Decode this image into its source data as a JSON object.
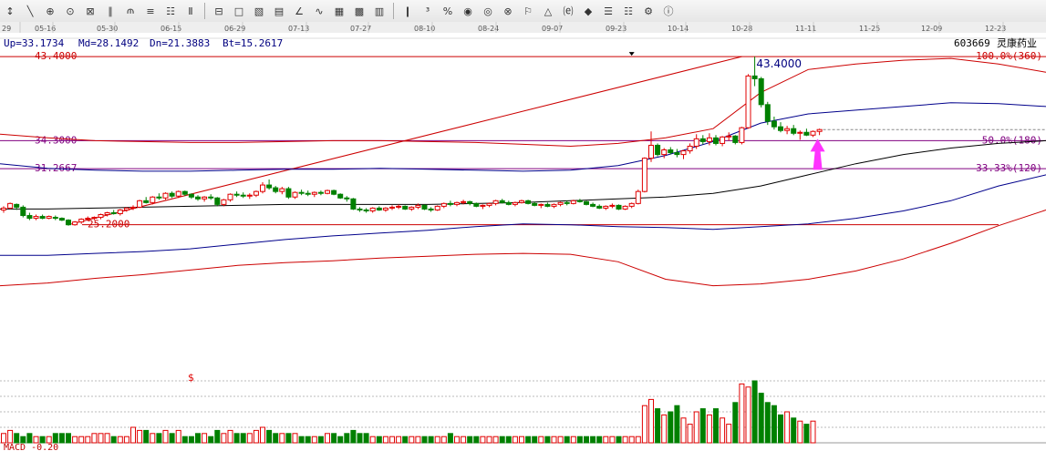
{
  "toolbar": {
    "buttons": [
      {
        "name": "period-icon",
        "glyph": "↕"
      },
      {
        "name": "draw-segment-icon",
        "glyph": "╲"
      },
      {
        "name": "target-icon",
        "glyph": "⊕"
      },
      {
        "name": "target-alt-icon",
        "glyph": "⊙"
      },
      {
        "name": "grid-icon",
        "glyph": "⊠"
      },
      {
        "name": "parallel-lines-icon",
        "glyph": "∥"
      },
      {
        "name": "fork-icon",
        "glyph": "⫙"
      },
      {
        "name": "layers-icon",
        "glyph": "≡"
      },
      {
        "name": "table-icon",
        "glyph": "☷"
      },
      {
        "name": "columns-icon",
        "glyph": "Ⅱ"
      },
      {
        "sep": true
      },
      {
        "name": "fibonacci-icon",
        "glyph": "⊟"
      },
      {
        "name": "rect-icon",
        "glyph": "□"
      },
      {
        "name": "channel-icon",
        "glyph": "▧"
      },
      {
        "name": "fan-icon",
        "glyph": "▤"
      },
      {
        "name": "angle-icon",
        "glyph": "∠"
      },
      {
        "name": "wave-icon",
        "glyph": "∿"
      },
      {
        "name": "boxes-icon",
        "glyph": "▦"
      },
      {
        "name": "calendar-icon",
        "glyph": "▩"
      },
      {
        "name": "ruler-icon",
        "glyph": "▥"
      },
      {
        "sep": true
      },
      {
        "name": "bar-chart-icon",
        "glyph": "❙"
      },
      {
        "name": "percent-icon",
        "glyph": "³"
      },
      {
        "name": "percent-sign-icon",
        "glyph": "%"
      },
      {
        "name": "gold-icon",
        "glyph": "◉"
      },
      {
        "name": "coin-icon",
        "glyph": "◎"
      },
      {
        "name": "lock-icon",
        "glyph": "⊗"
      },
      {
        "name": "flag-icon",
        "glyph": "⚐"
      },
      {
        "name": "alert-icon",
        "glyph": "△"
      },
      {
        "name": "text-icon",
        "glyph": "⒠"
      },
      {
        "name": "tag-icon",
        "glyph": "◆"
      },
      {
        "name": "lines-icon",
        "glyph": "☰"
      },
      {
        "name": "bars-icon",
        "glyph": "☷"
      },
      {
        "name": "settings-icon",
        "glyph": "⚙"
      },
      {
        "name": "info-icon",
        "glyph": "ⓘ"
      }
    ]
  },
  "chart_data": {
    "type": "candlestick",
    "stock": {
      "code": "603669",
      "name": "灵康药业"
    },
    "info": {
      "up": "Up=33.1734",
      "md": "Md=28.1492",
      "dn": "Dn=21.3883",
      "bt": "Bt=15.2617"
    },
    "dates": [
      "29",
      "05-16",
      "05-30",
      "06-15",
      "06-29",
      "07-13",
      "07-27",
      "08-10",
      "08-24",
      "09-07",
      "09-23",
      "10-14",
      "10-28",
      "11-11",
      "11-25",
      "12-09",
      "12-23"
    ],
    "ylim": [
      16,
      44
    ],
    "colors": {
      "up": "#e00000",
      "down": "#008000",
      "mid": "#000000",
      "boll": "#00008b",
      "outer": "#cc0000",
      "fib": "#800080",
      "arrow": "#ff33ff",
      "text": "#000080"
    },
    "fib_levels": [
      {
        "value": 43.4,
        "price_label": "43.4000",
        "pct_label": "100.0%(360)"
      },
      {
        "value": 34.3,
        "price_label": "34.3000",
        "pct_label": "50.0%(180)"
      },
      {
        "value": 31.2667,
        "price_label": "31.2667",
        "pct_label": "33.33%(120)"
      },
      {
        "value": 25.2,
        "price_label": "25.2000",
        "pct_label": ""
      }
    ],
    "peak_label": "43.4000",
    "volume_label": "$",
    "macd_label": "MACD -0.20",
    "candles": [
      [
        26.8,
        27.2,
        26.5,
        27.0
      ],
      [
        27.0,
        27.6,
        26.9,
        27.5
      ],
      [
        27.4,
        27.5,
        26.8,
        27.1
      ],
      [
        27.1,
        27.3,
        26.0,
        26.2
      ],
      [
        26.2,
        26.5,
        25.7,
        25.9
      ],
      [
        25.9,
        26.3,
        25.7,
        26.1
      ],
      [
        26.1,
        26.3,
        25.8,
        25.9
      ],
      [
        25.9,
        26.2,
        25.8,
        26.1
      ],
      [
        26.0,
        26.2,
        25.7,
        25.9
      ],
      [
        25.9,
        26.0,
        25.6,
        25.7
      ],
      [
        25.7,
        25.8,
        25.1,
        25.2
      ],
      [
        25.2,
        25.6,
        25.1,
        25.5
      ],
      [
        25.5,
        25.9,
        25.3,
        25.8
      ],
      [
        25.8,
        26.1,
        25.6,
        25.9
      ],
      [
        25.9,
        26.1,
        25.7,
        26.0
      ],
      [
        26.0,
        26.4,
        25.8,
        26.3
      ],
      [
        26.3,
        26.6,
        26.1,
        26.5
      ],
      [
        26.5,
        26.8,
        26.3,
        26.4
      ],
      [
        26.4,
        26.9,
        26.2,
        26.8
      ],
      [
        26.8,
        27.1,
        26.6,
        27.0
      ],
      [
        27.0,
        27.3,
        26.8,
        27.1
      ],
      [
        27.1,
        27.9,
        27.0,
        27.8
      ],
      [
        27.8,
        28.2,
        27.5,
        27.6
      ],
      [
        27.6,
        28.3,
        27.4,
        28.2
      ],
      [
        28.2,
        28.6,
        27.9,
        28.1
      ],
      [
        28.1,
        28.7,
        27.9,
        28.6
      ],
      [
        28.6,
        28.8,
        28.1,
        28.3
      ],
      [
        28.3,
        28.9,
        28.1,
        28.8
      ],
      [
        28.8,
        28.9,
        28.3,
        28.5
      ],
      [
        28.5,
        28.6,
        28.0,
        28.2
      ],
      [
        28.2,
        28.4,
        27.8,
        28.0
      ],
      [
        28.0,
        28.3,
        27.7,
        28.2
      ],
      [
        28.2,
        28.5,
        27.9,
        28.1
      ],
      [
        28.1,
        28.2,
        27.2,
        27.4
      ],
      [
        27.4,
        28.0,
        27.2,
        27.9
      ],
      [
        27.9,
        28.6,
        27.7,
        28.5
      ],
      [
        28.5,
        28.8,
        28.2,
        28.4
      ],
      [
        28.4,
        28.7,
        28.1,
        28.3
      ],
      [
        28.3,
        28.6,
        28.0,
        28.4
      ],
      [
        28.4,
        28.9,
        28.2,
        28.8
      ],
      [
        28.8,
        29.8,
        28.6,
        29.5
      ],
      [
        29.5,
        30.1,
        29.0,
        29.2
      ],
      [
        29.2,
        29.4,
        28.6,
        28.8
      ],
      [
        28.8,
        29.3,
        28.5,
        29.1
      ],
      [
        29.1,
        29.3,
        28.0,
        28.2
      ],
      [
        28.2,
        28.8,
        28.0,
        28.7
      ],
      [
        28.7,
        29.0,
        28.4,
        28.6
      ],
      [
        28.6,
        28.9,
        28.3,
        28.5
      ],
      [
        28.5,
        28.8,
        28.2,
        28.7
      ],
      [
        28.7,
        28.9,
        28.4,
        28.6
      ],
      [
        28.6,
        29.0,
        28.5,
        28.9
      ],
      [
        28.9,
        29.0,
        28.4,
        28.5
      ],
      [
        28.5,
        28.6,
        28.0,
        28.1
      ],
      [
        28.1,
        28.3,
        27.7,
        28.0
      ],
      [
        28.0,
        28.1,
        26.8,
        26.9
      ],
      [
        26.9,
        27.1,
        26.6,
        26.8
      ],
      [
        26.8,
        27.0,
        26.5,
        26.7
      ],
      [
        26.7,
        27.1,
        26.5,
        27.0
      ],
      [
        27.0,
        27.2,
        26.7,
        26.8
      ],
      [
        26.8,
        27.1,
        26.6,
        27.0
      ],
      [
        27.0,
        27.3,
        26.8,
        27.1
      ],
      [
        27.1,
        27.4,
        26.9,
        27.2
      ],
      [
        27.2,
        27.3,
        26.8,
        26.9
      ],
      [
        26.9,
        27.2,
        26.7,
        27.1
      ],
      [
        27.1,
        27.5,
        26.9,
        27.3
      ],
      [
        27.3,
        27.4,
        26.8,
        26.9
      ],
      [
        26.9,
        27.1,
        26.6,
        26.8
      ],
      [
        26.8,
        27.3,
        26.7,
        27.2
      ],
      [
        27.2,
        27.6,
        27.0,
        27.5
      ],
      [
        27.5,
        27.8,
        27.2,
        27.4
      ],
      [
        27.4,
        27.7,
        27.2,
        27.6
      ],
      [
        27.6,
        27.9,
        27.4,
        27.7
      ],
      [
        27.7,
        27.8,
        27.3,
        27.5
      ],
      [
        27.5,
        27.6,
        27.1,
        27.2
      ],
      [
        27.2,
        27.4,
        26.9,
        27.3
      ],
      [
        27.3,
        27.6,
        27.1,
        27.5
      ],
      [
        27.5,
        27.9,
        27.3,
        27.8
      ],
      [
        27.8,
        28.0,
        27.5,
        27.6
      ],
      [
        27.6,
        27.8,
        27.3,
        27.4
      ],
      [
        27.4,
        27.7,
        27.2,
        27.6
      ],
      [
        27.6,
        27.9,
        27.5,
        27.8
      ],
      [
        27.8,
        27.9,
        27.4,
        27.5
      ],
      [
        27.5,
        27.7,
        27.2,
        27.3
      ],
      [
        27.3,
        27.5,
        27.0,
        27.4
      ],
      [
        27.4,
        27.6,
        27.1,
        27.2
      ],
      [
        27.2,
        27.5,
        27.0,
        27.4
      ],
      [
        27.4,
        27.7,
        27.2,
        27.6
      ],
      [
        27.6,
        27.8,
        27.3,
        27.5
      ],
      [
        27.5,
        27.9,
        27.4,
        27.8
      ],
      [
        27.8,
        28.0,
        27.6,
        27.7
      ],
      [
        27.7,
        27.8,
        27.3,
        27.4
      ],
      [
        27.4,
        27.6,
        27.1,
        27.2
      ],
      [
        27.2,
        27.4,
        26.9,
        27.0
      ],
      [
        27.0,
        27.3,
        26.8,
        27.2
      ],
      [
        27.2,
        27.5,
        27.0,
        27.3
      ],
      [
        27.3,
        27.4,
        26.8,
        26.9
      ],
      [
        26.9,
        27.3,
        26.8,
        27.2
      ],
      [
        27.2,
        27.6,
        27.0,
        27.5
      ],
      [
        27.5,
        29.0,
        27.4,
        28.8
      ],
      [
        28.8,
        32.5,
        28.7,
        32.4
      ],
      [
        32.4,
        35.3,
        32.0,
        33.8
      ],
      [
        33.8,
        34.0,
        32.6,
        32.8
      ],
      [
        32.8,
        33.5,
        32.4,
        33.3
      ],
      [
        33.3,
        33.6,
        32.8,
        33.0
      ],
      [
        33.0,
        33.4,
        32.5,
        32.8
      ],
      [
        32.8,
        33.3,
        32.3,
        33.2
      ],
      [
        33.2,
        34.0,
        32.9,
        33.7
      ],
      [
        33.7,
        35.0,
        33.4,
        34.5
      ],
      [
        34.5,
        34.9,
        33.9,
        34.2
      ],
      [
        34.2,
        35.1,
        33.8,
        34.6
      ],
      [
        34.6,
        34.9,
        33.8,
        34.0
      ],
      [
        34.0,
        34.8,
        33.7,
        34.7
      ],
      [
        34.7,
        35.2,
        34.3,
        34.8
      ],
      [
        34.8,
        34.9,
        33.9,
        34.1
      ],
      [
        34.1,
        35.8,
        33.9,
        35.7
      ],
      [
        35.7,
        41.5,
        35.6,
        41.3
      ],
      [
        41.3,
        43.4,
        40.2,
        41.0
      ],
      [
        41.0,
        41.2,
        37.9,
        38.2
      ],
      [
        38.2,
        38.5,
        36.0,
        36.4
      ],
      [
        36.4,
        36.9,
        35.5,
        35.8
      ],
      [
        35.8,
        36.3,
        35.2,
        35.4
      ],
      [
        35.4,
        35.9,
        35.0,
        35.6
      ],
      [
        35.6,
        36.0,
        34.9,
        35.1
      ],
      [
        35.1,
        35.4,
        34.4,
        35.2
      ],
      [
        35.2,
        35.6,
        34.8,
        34.9
      ],
      [
        34.9,
        35.4,
        34.7,
        35.3
      ],
      [
        35.3,
        35.6,
        34.9,
        35.5
      ]
    ],
    "mid_band": [
      26.9,
      26.9,
      27.0,
      27.1,
      27.2,
      27.3,
      27.4,
      27.4,
      27.4,
      27.4,
      27.5,
      27.6,
      27.8,
      28.0,
      28.2,
      28.6,
      29.4,
      30.6,
      31.8,
      32.8,
      33.5,
      34.0,
      34.3
    ],
    "upper_band": [
      35.0,
      34.6,
      34.3,
      34.2,
      34.1,
      34.1,
      34.2,
      34.3,
      34.3,
      34.2,
      34.1,
      33.9,
      33.7,
      34.0,
      34.6,
      35.6,
      39.5,
      42.0,
      42.6,
      43.0,
      43.2,
      42.6,
      41.7
    ],
    "bb_upper": [
      31.8,
      31.3,
      31.1,
      31.0,
      31.0,
      31.1,
      31.2,
      31.2,
      31.3,
      31.2,
      31.1,
      31.0,
      31.1,
      31.6,
      32.7,
      34.2,
      36.2,
      37.2,
      37.6,
      38.0,
      38.4,
      38.3,
      38.0
    ],
    "bb_lower": [
      21.9,
      21.9,
      22.1,
      22.3,
      22.6,
      23.1,
      23.6,
      24.0,
      24.3,
      24.6,
      25.0,
      25.3,
      25.2,
      25.0,
      24.9,
      24.7,
      25.0,
      25.3,
      25.9,
      26.7,
      27.8,
      29.4,
      30.6
    ],
    "lower_band": [
      18.6,
      18.9,
      19.4,
      19.8,
      20.3,
      20.8,
      21.1,
      21.3,
      21.6,
      21.8,
      22.0,
      22.1,
      22.0,
      21.2,
      19.3,
      18.6,
      18.8,
      19.3,
      20.2,
      21.5,
      23.2,
      25.1,
      26.8
    ],
    "volumes": [
      3,
      4,
      3,
      2,
      3,
      2,
      2,
      2,
      3,
      3,
      3,
      2,
      2,
      2,
      3,
      3,
      3,
      2,
      2,
      2,
      5,
      4,
      4,
      3,
      3,
      4,
      3,
      4,
      2,
      2,
      3,
      3,
      2,
      4,
      3,
      4,
      3,
      3,
      3,
      4,
      5,
      4,
      3,
      3,
      3,
      3,
      2,
      2,
      2,
      2,
      3,
      3,
      2,
      3,
      4,
      3,
      3,
      2,
      2,
      2,
      2,
      2,
      2,
      2,
      2,
      2,
      2,
      2,
      2,
      3,
      2,
      2,
      2,
      2,
      2,
      2,
      2,
      2,
      2,
      2,
      2,
      2,
      2,
      2,
      2,
      2,
      2,
      2,
      2,
      2,
      2,
      2,
      2,
      2,
      2,
      2,
      2,
      2,
      2,
      12,
      14,
      11,
      9,
      10,
      12,
      8,
      6,
      10,
      11,
      9,
      11,
      8,
      6,
      13,
      19,
      18,
      20,
      16,
      13,
      12,
      9,
      10,
      8,
      7,
      6,
      7
    ],
    "vol_max": 20
  }
}
